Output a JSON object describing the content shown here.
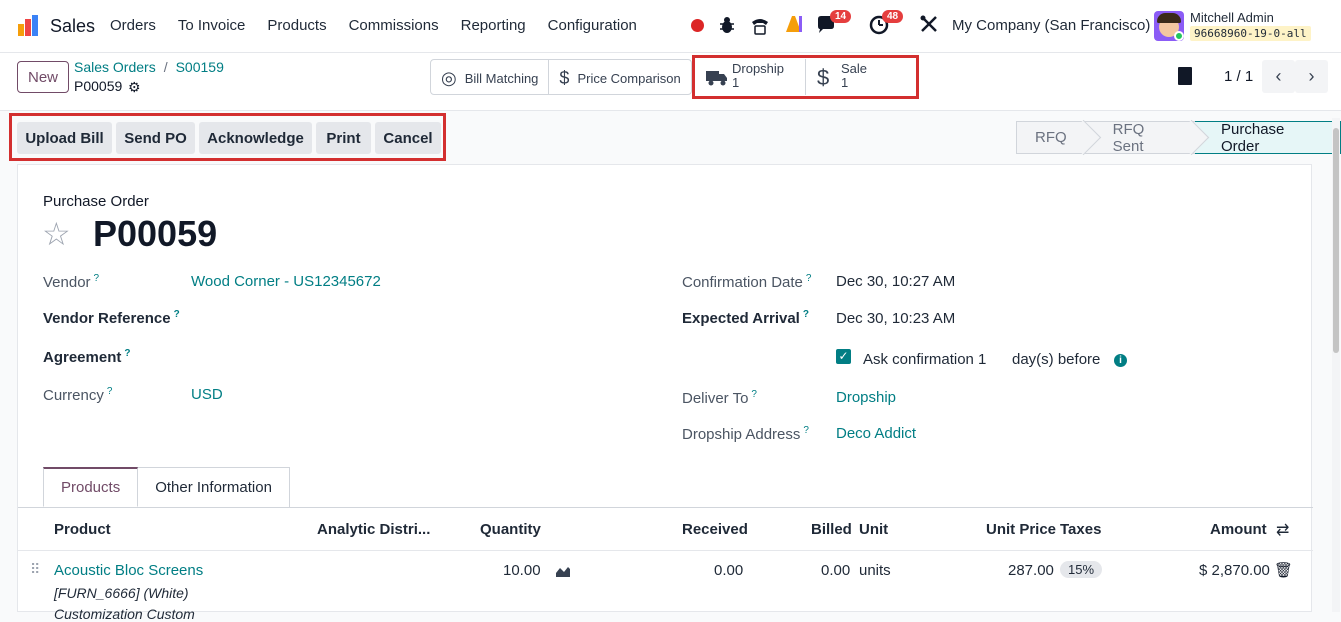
{
  "topbar": {
    "app_name": "Sales",
    "menu": [
      "Orders",
      "To Invoice",
      "Products",
      "Commissions",
      "Reporting",
      "Configuration"
    ],
    "chat_count": "14",
    "activity_count": "48",
    "company": "My Company (San Francisco)",
    "user_name": "Mitchell Admin",
    "db_name": "96668960-19-0-all"
  },
  "control": {
    "new_label": "New",
    "breadcrumb": [
      "Sales Orders",
      "S00159"
    ],
    "record_name": "P00059",
    "smart_buttons": [
      {
        "label": "Bill Matching"
      },
      {
        "label": "Price Comparison"
      },
      {
        "label": "Dropship",
        "count": "1"
      },
      {
        "label": "Sale",
        "count": "1"
      }
    ],
    "pager": "1 / 1"
  },
  "actions": [
    "Upload Bill",
    "Send PO",
    "Acknowledge",
    "Print",
    "Cancel"
  ],
  "stages": [
    "RFQ",
    "RFQ Sent",
    "Purchase Order"
  ],
  "form": {
    "doc_type": "Purchase Order",
    "title": "P00059",
    "vendor_label": "Vendor",
    "vendor": "Wood Corner - US12345672",
    "vendor_ref_label": "Vendor Reference",
    "agreement_label": "Agreement",
    "currency_label": "Currency",
    "currency": "USD",
    "confirmation_date_label": "Confirmation Date",
    "confirmation_date": "Dec 30, 10:27 AM",
    "expected_arrival_label": "Expected Arrival",
    "expected_arrival": "Dec 30, 10:23 AM",
    "ask_confirmation_label": "Ask confirmation",
    "ask_confirmation_days": "1",
    "days_before": "day(s) before",
    "deliver_to_label": "Deliver To",
    "deliver_to": "Dropship",
    "dropship_address_label": "Dropship Address",
    "dropship_address": "Deco Addict",
    "help_mark": "?"
  },
  "tabs": [
    "Products",
    "Other Information"
  ],
  "table": {
    "headers": [
      "Product",
      "Analytic Distri...",
      "Quantity",
      "Received",
      "Billed",
      "Unit",
      "Unit Price",
      "Taxes",
      "Amount"
    ],
    "row": {
      "product": "Acoustic Bloc Screens",
      "variant": "[FURN_6666]  (White)",
      "desc": "Customization Custom",
      "quantity": "10.00",
      "received": "0.00",
      "billed": "0.00",
      "unit": "units",
      "unit_price": "287.00",
      "taxes": "15%",
      "amount": "$ 2,870.00"
    }
  },
  "colors": {
    "brand": "#714b67",
    "link": "#017e84",
    "highlight": "#d32f2f"
  }
}
